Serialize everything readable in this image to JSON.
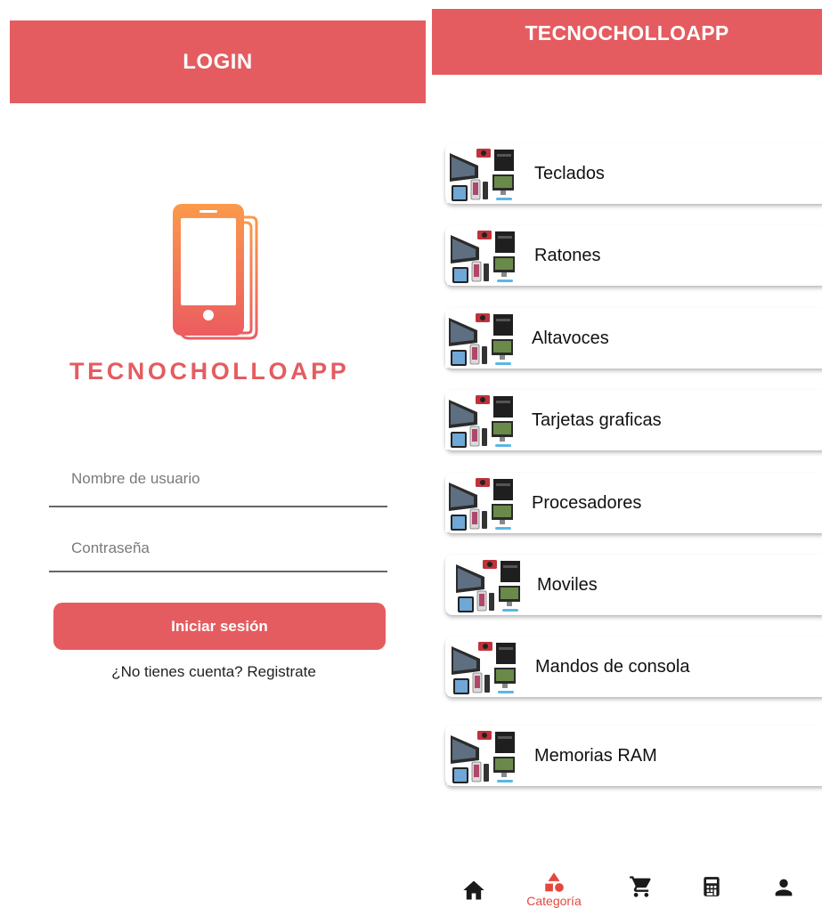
{
  "colors": {
    "primary": "#E45C60",
    "logo_gradient_top": "#FB9A4B",
    "logo_gradient_bottom": "#EC5C60",
    "nav_active": "#E4473E",
    "nav_inactive": "#1A1A1A"
  },
  "login": {
    "header_title": "LOGIN",
    "brand_name": "TECNOCHOLLOAPP",
    "username_placeholder": "Nombre de usuario",
    "password_placeholder": "Contraseña",
    "submit_label": "Iniciar sesión",
    "register_text": "¿No tienes cuenta? Registrate"
  },
  "categories": {
    "header_title": "TECNOCHOLLOAPP",
    "items": [
      {
        "label": "Teclados",
        "thumb_icon": "electronics-collage-thumbnail"
      },
      {
        "label": "Ratones",
        "thumb_icon": "electronics-collage-thumbnail"
      },
      {
        "label": "Altavoces",
        "thumb_icon": "electronics-collage-thumbnail"
      },
      {
        "label": "Tarjetas graficas",
        "thumb_icon": "electronics-collage-thumbnail"
      },
      {
        "label": "Procesadores",
        "thumb_icon": "electronics-collage-thumbnail"
      },
      {
        "label": "Moviles",
        "thumb_icon": "electronics-collage-thumbnail"
      },
      {
        "label": "Mandos de consola",
        "thumb_icon": "electronics-collage-thumbnail"
      },
      {
        "label": "Memorias RAM",
        "thumb_icon": "electronics-collage-thumbnail"
      }
    ]
  },
  "bottom_nav": {
    "items": [
      {
        "icon": "home-icon",
        "label": "",
        "active": false
      },
      {
        "icon": "shapes-icon",
        "label": "Categoría",
        "active": true
      },
      {
        "icon": "cart-icon",
        "label": "",
        "active": false
      },
      {
        "icon": "calculator-icon",
        "label": "",
        "active": false
      },
      {
        "icon": "person-icon",
        "label": "",
        "active": false
      }
    ]
  }
}
